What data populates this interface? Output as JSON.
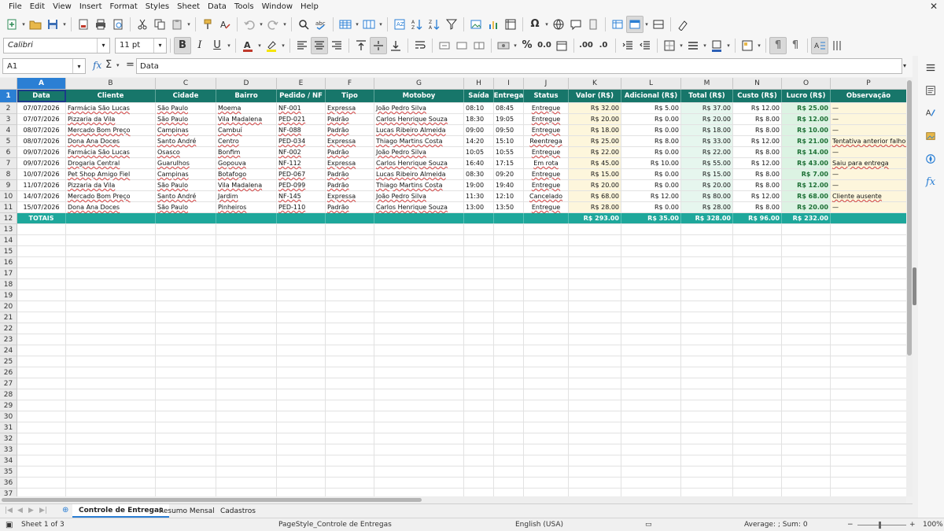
{
  "menu": [
    "File",
    "Edit",
    "View",
    "Insert",
    "Format",
    "Styles",
    "Sheet",
    "Data",
    "Tools",
    "Window",
    "Help"
  ],
  "formatting": {
    "font_name": "Calibri",
    "font_size": "11 pt",
    "font_color": "#c0392b",
    "highlight_color": "#f5e400",
    "bold_label": "B",
    "italic_label": "I",
    "underline_label": "U",
    "percent_label": "%",
    "decimal_label": "0.0"
  },
  "formula_bar": {
    "cell_ref": "A1",
    "content": "Data"
  },
  "columns": [
    "A",
    "B",
    "C",
    "D",
    "E",
    "F",
    "G",
    "H",
    "I",
    "J",
    "K",
    "L",
    "M",
    "N",
    "O",
    "P"
  ],
  "table": {
    "headers": [
      "Data",
      "Cliente",
      "Cidade",
      "Bairro",
      "Pedido / NF",
      "Tipo",
      "Motoboy",
      "Saída",
      "Entrega",
      "Status",
      "Valor (R$)",
      "Adicional (R$)",
      "Total (R$)",
      "Custo (R$)",
      "Lucro (R$)",
      "Observação"
    ],
    "rows": [
      [
        "07/07/2026",
        "Farmácia São Lucas",
        "São Paulo",
        "Moema",
        "NF-001",
        "Expressa",
        "João Pedro Silva",
        "08:10",
        "08:45",
        "Entregue",
        "R$ 32.00",
        "R$ 5.00",
        "R$ 37.00",
        "R$ 12.00",
        "R$ 25.00",
        "—"
      ],
      [
        "07/07/2026",
        "Pizzaria da Vila",
        "São Paulo",
        "Vila Madalena",
        "PED-021",
        "Padrão",
        "Carlos Henrique Souza",
        "18:30",
        "19:05",
        "Entregue",
        "R$ 20.00",
        "R$ 0.00",
        "R$ 20.00",
        "R$ 8.00",
        "R$ 12.00",
        "—"
      ],
      [
        "08/07/2026",
        "Mercado Bom Preço",
        "Campinas",
        "Cambuí",
        "NF-088",
        "Padrão",
        "Lucas Ribeiro Almeida",
        "09:00",
        "09:50",
        "Entregue",
        "R$ 18.00",
        "R$ 0.00",
        "R$ 18.00",
        "R$ 8.00",
        "R$ 10.00",
        "—"
      ],
      [
        "08/07/2026",
        "Dona Ana Doces",
        "Santo André",
        "Centro",
        "PED-034",
        "Expressa",
        "Thiago Martins Costa",
        "14:20",
        "15:10",
        "Reentrega",
        "R$ 25.00",
        "R$ 8.00",
        "R$ 33.00",
        "R$ 12.00",
        "R$ 21.00",
        "Tentativa anterior falhou"
      ],
      [
        "09/07/2026",
        "Farmácia São Lucas",
        "Osasco",
        "Bonfim",
        "NF-002",
        "Padrão",
        "João Pedro Silva",
        "10:05",
        "10:55",
        "Entregue",
        "R$ 22.00",
        "R$ 0.00",
        "R$ 22.00",
        "R$ 8.00",
        "R$ 14.00",
        "—"
      ],
      [
        "09/07/2026",
        "Drogaria Central",
        "Guarulhos",
        "Gopouva",
        "NF-112",
        "Expressa",
        "Carlos Henrique Souza",
        "16:40",
        "17:15",
        "Em rota",
        "R$ 45.00",
        "R$ 10.00",
        "R$ 55.00",
        "R$ 12.00",
        "R$ 43.00",
        "Saiu para entrega"
      ],
      [
        "10/07/2026",
        "Pet Shop Amigo Fiel",
        "Campinas",
        "Botafogo",
        "PED-067",
        "Padrão",
        "Lucas Ribeiro Almeida",
        "08:30",
        "09:20",
        "Entregue",
        "R$ 15.00",
        "R$ 0.00",
        "R$ 15.00",
        "R$ 8.00",
        "R$ 7.00",
        "—"
      ],
      [
        "11/07/2026",
        "Pizzaria da Vila",
        "São Paulo",
        "Vila Madalena",
        "PED-099",
        "Padrão",
        "Thiago Martins Costa",
        "19:00",
        "19:40",
        "Entregue",
        "R$ 20.00",
        "R$ 0.00",
        "R$ 20.00",
        "R$ 8.00",
        "R$ 12.00",
        "—"
      ],
      [
        "14/07/2026",
        "Mercado Bom Preço",
        "Santo André",
        "Jardim",
        "NF-145",
        "Expressa",
        "João Pedro Silva",
        "11:30",
        "12:10",
        "Cancelado",
        "R$ 68.00",
        "R$ 12.00",
        "R$ 80.00",
        "R$ 12.00",
        "R$ 68.00",
        "Cliente ausente"
      ],
      [
        "15/07/2026",
        "Dona Ana Doces",
        "São Paulo",
        "Pinheiros",
        "PED-110",
        "Padrão",
        "Carlos Henrique Souza",
        "13:00",
        "13:50",
        "Entregue",
        "R$ 28.00",
        "R$ 0.00",
        "R$ 28.00",
        "R$ 8.00",
        "R$ 20.00",
        "—"
      ]
    ],
    "totals": [
      "TOTAIS",
      "",
      "",
      "",
      "",
      "",
      "",
      "",
      "",
      "",
      "R$ 293.00",
      "R$ 35.00",
      "R$ 328.00",
      "R$ 96.00",
      "R$ 232.00",
      ""
    ],
    "row_numbers": [
      "1",
      "2",
      "3",
      "4",
      "5",
      "6",
      "7",
      "8",
      "9",
      "10",
      "11",
      "12",
      "13",
      "14",
      "15",
      "16",
      "17",
      "18",
      "19",
      "20",
      "21",
      "22",
      "23",
      "24",
      "25",
      "26",
      "27",
      "28",
      "29",
      "30",
      "31",
      "32",
      "33",
      "34",
      "35",
      "36",
      "37"
    ],
    "header_color": "#17766a",
    "totals_color": "#1ea79b"
  },
  "sheet_tabs": [
    "Controle de Entregas",
    "Resumo Mensal",
    "Cadastros"
  ],
  "status": {
    "sheet_info": "Sheet 1 of 3",
    "page_style": "PageStyle_Controle de Entregas",
    "language": "English (USA)",
    "selection_summary": "Average: ; Sum: 0",
    "zoom": "100%"
  }
}
